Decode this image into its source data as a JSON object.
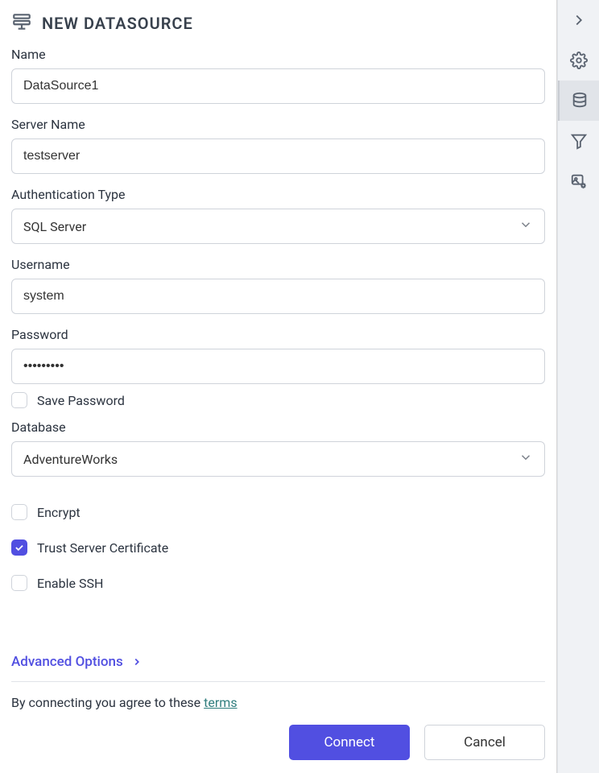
{
  "header": {
    "title": "NEW DATASOURCE"
  },
  "form": {
    "name": {
      "label": "Name",
      "value": "DataSource1"
    },
    "serverName": {
      "label": "Server Name",
      "value": "testserver"
    },
    "authType": {
      "label": "Authentication Type",
      "value": "SQL Server"
    },
    "username": {
      "label": "Username",
      "value": "system"
    },
    "password": {
      "label": "Password",
      "value": "•••••••••"
    },
    "savePassword": {
      "label": "Save Password",
      "checked": false
    },
    "database": {
      "label": "Database",
      "value": "AdventureWorks"
    },
    "encrypt": {
      "label": "Encrypt",
      "checked": false
    },
    "trustCert": {
      "label": "Trust Server Certificate",
      "checked": true
    },
    "enableSsh": {
      "label": "Enable SSH",
      "checked": false
    }
  },
  "advancedOptions": "Advanced Options",
  "termsText": "By connecting you agree to these ",
  "termsLink": "terms",
  "buttons": {
    "connect": "Connect",
    "cancel": "Cancel"
  },
  "rail": {
    "collapse": "collapse-panel",
    "settings": "settings",
    "datasource": "datasource",
    "filter": "filter",
    "image": "image-settings"
  }
}
